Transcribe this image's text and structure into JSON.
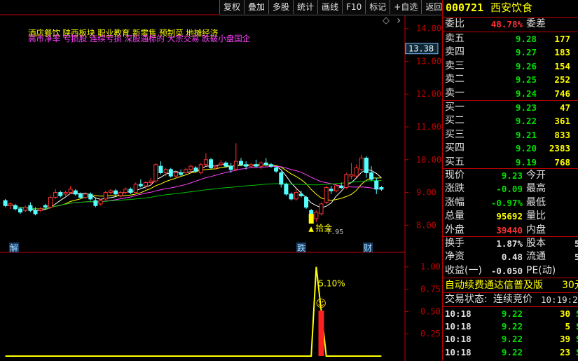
{
  "toolbar": [
    "复权",
    "叠加",
    "多股",
    "统计",
    "画线",
    "F10",
    "标记",
    "+自选",
    "返回"
  ],
  "chart": {
    "notes_line1": "酒店餐饮 陕西板块 职业教育 新零售 预制菜 地摊经济",
    "notes_line2": "高市净率 亏损股 连续亏损 深股通标的 大宗交易 跌破小盘国企",
    "price_axis": [
      "14.00",
      "13.00",
      "12.00",
      "11.00",
      "10.00",
      "9.00",
      "8.00"
    ],
    "current_price_tag": "13.38",
    "low_marker": "7.95",
    "pick_label": "拾金",
    "event_markers": [
      "解",
      "跌",
      "财"
    ],
    "indicator_axis": [
      "1.00",
      "0.75",
      "0.50",
      "0.25"
    ],
    "indicator_pct": "5.10%",
    "smiley": "☺",
    "diamond": "◇",
    "scroll_arrow": "›"
  },
  "colors": {
    "up": "#ff3232",
    "down": "#54ffff",
    "ma1": "#ffffff",
    "ma2": "#ffff00",
    "ma3": "#ff40ff",
    "ma4": "#00c000"
  },
  "chart_data": {
    "type": "candlestick",
    "ylim": [
      7.6,
      14.4
    ],
    "candles": [
      [
        8.75,
        8.8,
        8.55,
        8.6
      ],
      [
        8.6,
        8.7,
        8.5,
        8.65
      ],
      [
        8.6,
        8.65,
        8.45,
        8.5
      ],
      [
        8.5,
        8.55,
        8.35,
        8.4
      ],
      [
        8.45,
        8.6,
        8.4,
        8.55
      ],
      [
        8.6,
        8.7,
        8.4,
        8.45
      ],
      [
        8.45,
        8.55,
        8.3,
        8.35
      ],
      [
        8.45,
        8.55,
        8.4,
        8.5
      ],
      [
        8.6,
        8.65,
        8.5,
        8.55
      ],
      [
        8.55,
        8.9,
        8.5,
        8.85
      ],
      [
        8.85,
        9.1,
        8.8,
        9.0
      ],
      [
        9.0,
        9.05,
        8.85,
        8.9
      ],
      [
        8.95,
        9.05,
        8.9,
        9.0
      ],
      [
        9.0,
        9.2,
        8.95,
        9.1
      ],
      [
        9.05,
        9.1,
        8.9,
        8.95
      ],
      [
        8.95,
        9.0,
        8.8,
        8.85
      ],
      [
        8.85,
        9.0,
        8.8,
        8.95
      ],
      [
        8.95,
        9.0,
        8.75,
        8.8
      ],
      [
        8.75,
        8.85,
        8.55,
        8.6
      ],
      [
        8.65,
        8.8,
        8.6,
        8.75
      ],
      [
        8.8,
        9.05,
        8.75,
        9.0
      ],
      [
        9.0,
        9.1,
        8.95,
        9.05
      ],
      [
        9.05,
        9.1,
        8.9,
        8.95
      ],
      [
        8.9,
        9.05,
        8.85,
        9.0
      ],
      [
        9.0,
        9.15,
        8.95,
        9.1
      ],
      [
        9.1,
        9.15,
        8.95,
        9.0
      ],
      [
        9.0,
        9.3,
        9.0,
        9.25
      ],
      [
        9.25,
        9.4,
        9.15,
        9.2
      ],
      [
        9.2,
        9.35,
        9.1,
        9.3
      ],
      [
        9.3,
        9.45,
        9.2,
        9.35
      ],
      [
        9.35,
        9.9,
        9.3,
        9.85
      ],
      [
        9.8,
        9.95,
        9.55,
        9.6
      ],
      [
        9.6,
        9.75,
        9.5,
        9.7
      ],
      [
        9.7,
        9.75,
        9.45,
        9.5
      ],
      [
        9.5,
        9.65,
        9.4,
        9.6
      ],
      [
        9.6,
        9.7,
        9.5,
        9.55
      ],
      [
        9.6,
        9.75,
        9.55,
        9.7
      ],
      [
        9.7,
        9.85,
        9.6,
        9.8
      ],
      [
        9.75,
        9.8,
        9.6,
        9.65
      ],
      [
        9.6,
        9.9,
        9.55,
        9.85
      ],
      [
        9.85,
        10.2,
        9.8,
        10.0
      ],
      [
        10.0,
        10.05,
        9.7,
        9.75
      ],
      [
        9.75,
        9.85,
        9.7,
        9.8
      ],
      [
        9.85,
        10.0,
        9.8,
        9.9
      ],
      [
        9.9,
        9.95,
        9.75,
        9.8
      ],
      [
        9.8,
        9.9,
        9.6,
        9.7
      ],
      [
        9.7,
        10.5,
        9.65,
        9.95
      ],
      [
        9.95,
        10.05,
        9.8,
        9.85
      ],
      [
        9.85,
        9.95,
        9.7,
        9.8
      ],
      [
        9.8,
        9.9,
        9.75,
        9.85
      ],
      [
        9.85,
        10.0,
        9.75,
        9.8
      ],
      [
        9.8,
        9.95,
        9.7,
        9.9
      ],
      [
        9.9,
        10.05,
        9.8,
        9.85
      ],
      [
        9.85,
        9.9,
        9.75,
        9.8
      ],
      [
        9.75,
        9.8,
        9.6,
        9.65
      ],
      [
        9.6,
        9.65,
        9.15,
        9.25
      ],
      [
        9.25,
        9.3,
        8.9,
        8.95
      ],
      [
        8.95,
        9.0,
        8.75,
        8.8
      ],
      [
        8.8,
        9.1,
        8.75,
        9.0
      ],
      [
        8.95,
        9.05,
        8.85,
        8.9
      ],
      [
        8.85,
        8.9,
        8.5,
        8.55
      ],
      [
        8.45,
        8.5,
        8.1,
        8.15
      ],
      [
        8.2,
        8.45,
        8.1,
        8.4
      ],
      [
        8.35,
        8.7,
        8.3,
        8.65
      ],
      [
        8.7,
        9.2,
        8.65,
        9.15
      ],
      [
        9.1,
        9.2,
        8.95,
        9.05
      ],
      [
        9.05,
        9.25,
        9.0,
        9.2
      ],
      [
        9.2,
        9.3,
        9.1,
        9.15
      ],
      [
        9.15,
        9.6,
        9.1,
        9.55
      ],
      [
        9.5,
        9.9,
        9.4,
        9.55
      ],
      [
        9.5,
        9.85,
        9.45,
        9.75
      ],
      [
        9.7,
        10.15,
        9.65,
        10.05
      ],
      [
        10.05,
        10.1,
        9.45,
        9.6
      ],
      [
        9.6,
        9.8,
        9.35,
        9.4
      ],
      [
        9.35,
        9.45,
        8.95,
        9.1
      ],
      [
        9.15,
        9.2,
        9.05,
        9.1
      ]
    ],
    "indicator": [
      0,
      0,
      0,
      0,
      0,
      0,
      0,
      0,
      0,
      0,
      0,
      0,
      0,
      0,
      0,
      0,
      0,
      0,
      0,
      0,
      0,
      0,
      0,
      0,
      0,
      0,
      0,
      0,
      0,
      0,
      0,
      0,
      0,
      0,
      0,
      0,
      0,
      0,
      0,
      0,
      0,
      0,
      0,
      0,
      0,
      0,
      0,
      0,
      0,
      0,
      0,
      0,
      0,
      0,
      0,
      0,
      0,
      0,
      0,
      0,
      0,
      0,
      1.0,
      0.51,
      0,
      0,
      0,
      0,
      0,
      0,
      0,
      0,
      0,
      0,
      0,
      0
    ],
    "indicator_ylim": [
      0,
      1.1
    ]
  },
  "panel": {
    "code": "000721",
    "name": "西安饮食",
    "weibi_label": "委比",
    "weibi_value": "48.78%",
    "weicha_label": "委差",
    "sells": [
      {
        "label": "卖五",
        "price": "9.28",
        "vol": "177"
      },
      {
        "label": "卖四",
        "price": "9.27",
        "vol": "183"
      },
      {
        "label": "卖三",
        "price": "9.26",
        "vol": "154"
      },
      {
        "label": "卖二",
        "price": "9.25",
        "vol": "252"
      },
      {
        "label": "卖一",
        "price": "9.24",
        "vol": "746"
      }
    ],
    "buys": [
      {
        "label": "买一",
        "price": "9.23",
        "vol": "47"
      },
      {
        "label": "买二",
        "price": "9.22",
        "vol": "361"
      },
      {
        "label": "买三",
        "price": "9.21",
        "vol": "833"
      },
      {
        "label": "买四",
        "price": "9.20",
        "vol": "2383"
      },
      {
        "label": "买五",
        "price": "9.19",
        "vol": "768"
      }
    ],
    "quote": [
      {
        "l1": "现价",
        "v1": "9.23",
        "l2": "今开"
      },
      {
        "l1": "涨跌",
        "v1": "-0.09",
        "l2": "最高"
      },
      {
        "l1": "涨幅",
        "v1": "-0.97%",
        "l2": "最低"
      },
      {
        "l1": "总量",
        "v1": "95692",
        "l2": "量比"
      },
      {
        "l1": "外盘",
        "v1": "39440",
        "l2": "内盘"
      }
    ],
    "fin": [
      {
        "l1": "换手",
        "v1": "1.87%",
        "l2": "股本",
        "v2": "5"
      },
      {
        "l1": "净资",
        "v1": "0.48",
        "l2": "流通",
        "v2": "5"
      },
      {
        "l1": "收益(一)",
        "v1": "-0.050",
        "l2": "PE(动)",
        "v2": ""
      }
    ],
    "ad_text": "自动续费通达信普及版",
    "ad_price": "30元",
    "trade_label": "交易状态:",
    "trade_status": "连续竞价",
    "trade_time": "10:19:24",
    "ticks": [
      {
        "time": "10:18",
        "price": "9.22",
        "vol": "30",
        "dir": "S"
      },
      {
        "time": "10:18",
        "price": "9.22",
        "vol": "5",
        "dir": "S"
      },
      {
        "time": "10:18",
        "price": "9.22",
        "vol": "39",
        "dir": "S"
      },
      {
        "time": "10:18",
        "price": "9.22",
        "vol": "23",
        "dir": "S"
      }
    ]
  }
}
